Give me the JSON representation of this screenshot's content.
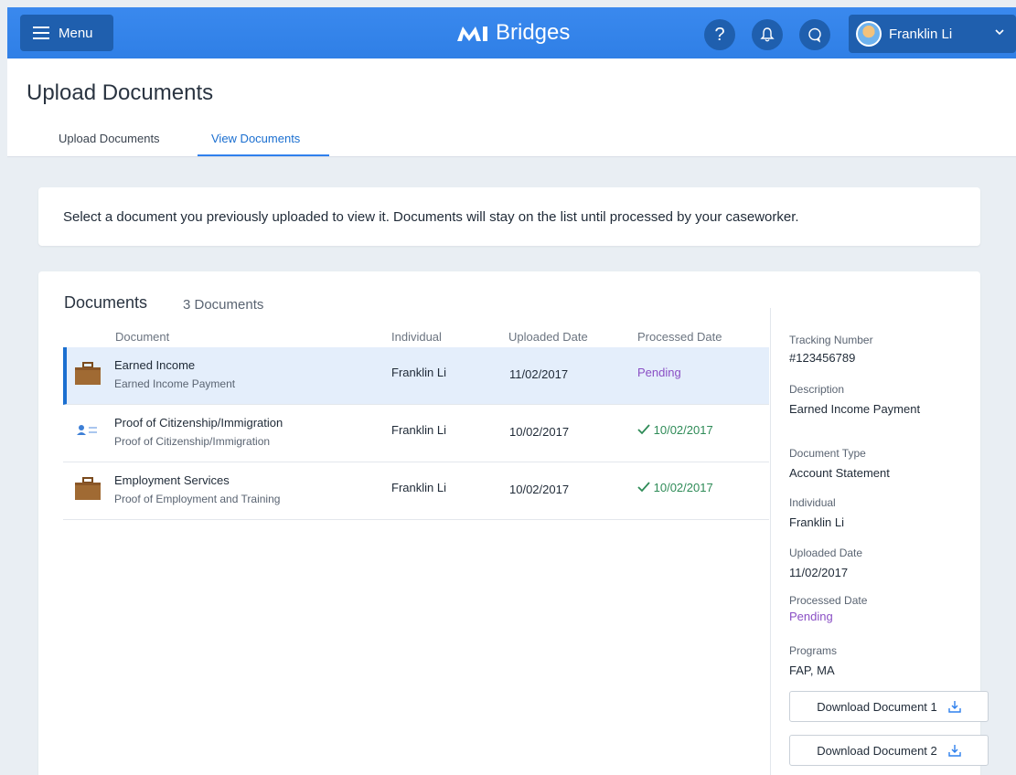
{
  "topbar": {
    "menu_label": "Menu",
    "brand": "Bridges",
    "help_symbol": "?",
    "user_name": "Franklin Li",
    "icons": [
      "menu-icon",
      "mi-logo-icon",
      "help-icon",
      "bell-icon",
      "chat-icon",
      "avatar",
      "chevron-down-icon"
    ]
  },
  "header": {
    "title": "Upload Documents",
    "tabs": [
      {
        "label": "Upload Documents"
      },
      {
        "label": "View Documents"
      }
    ],
    "active_tab": "View Documents"
  },
  "info": {
    "text": "Select a document you previously uploaded to view it. Documents will stay on the list until processed by your caseworker."
  },
  "documents": {
    "title": "Documents",
    "count": "3 Documents",
    "columns": [
      "Document",
      "Individual",
      "Uploaded Date",
      "Processed Date"
    ],
    "rows": [
      {
        "title": "Earned Income",
        "sub": "Earned Income Payment",
        "individual": "Franklin Li",
        "uploaded": "11/02/2017",
        "processed": "Pending",
        "status": "pending",
        "icon": "briefcase-icon",
        "selected": true
      },
      {
        "title": "Proof of Citizenship/Immigration",
        "sub": "Proof of Citizenship/Immigration",
        "individual": "Franklin Li",
        "uploaded": "10/02/2017",
        "processed": "10/02/2017",
        "status": "processed",
        "icon": "id-card-icon",
        "selected": false
      },
      {
        "title": "Employment Services",
        "sub": "Proof of Employment and Training",
        "individual": "Franklin Li",
        "uploaded": "10/02/2017",
        "processed": "10/02/2017",
        "status": "processed",
        "icon": "briefcase-icon",
        "selected": false
      }
    ]
  },
  "detail": {
    "tracking_label": "Tracking Number",
    "tracking_value": "#123456789",
    "description_label": "Description",
    "description_value": "Earned Income Payment",
    "type_label": "Document Type",
    "type_value": "Account Statement",
    "individual_label": "Individual",
    "individual_value": "Franklin Li",
    "uploaded_label": "Uploaded Date",
    "uploaded_value": "11/02/2017",
    "processed_label": "Processed Date",
    "processed_value": "Pending",
    "programs_label": "Programs",
    "programs_value": "FAP, MA",
    "download1": "Download Document 1",
    "download2": "Download Document 2"
  },
  "colors": {
    "topbar": "#2f80ed",
    "topbar_button": "#1f5fae",
    "accent": "#1b6fd0",
    "pending": "#8a4fc5",
    "processed": "#2e8b57",
    "selected_row": "#e4eefb"
  }
}
